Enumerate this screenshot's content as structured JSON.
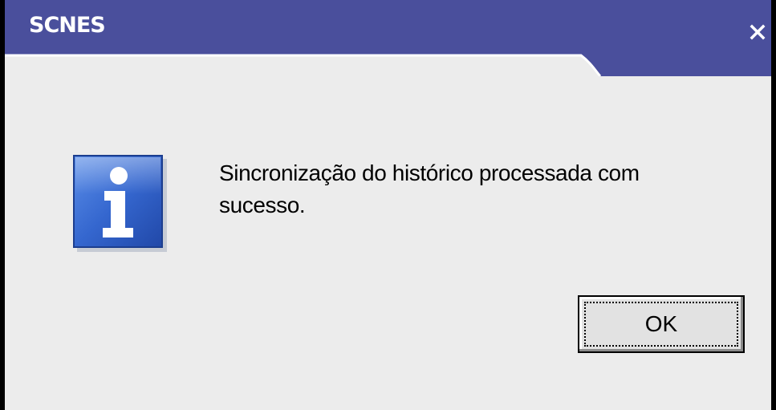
{
  "window": {
    "title": "SCNES",
    "close_symbol": "×"
  },
  "icon": {
    "name": "info-icon",
    "color": "#2f63c8"
  },
  "message": {
    "line1": "Sincronização do histórico processada com",
    "line2": "sucesso."
  },
  "buttons": {
    "ok_label": "OK"
  },
  "colors": {
    "titlebar": "#4a4f9c",
    "background": "#ececec"
  }
}
